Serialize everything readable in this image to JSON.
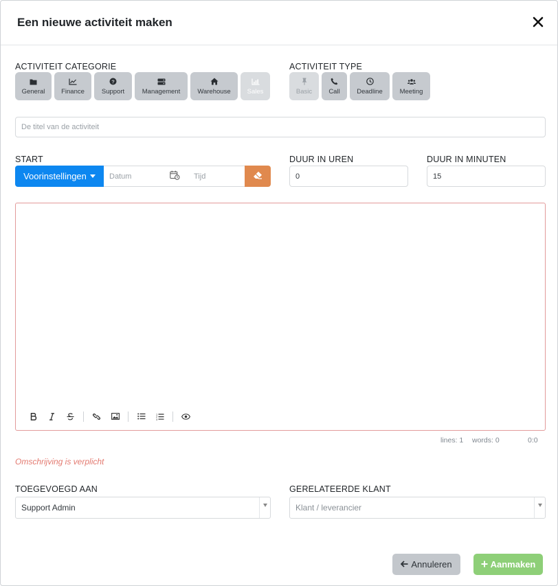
{
  "modal": {
    "title": "Een nieuwe activiteit maken",
    "close_icon": "close-icon"
  },
  "category": {
    "label": "ACTIVITEIT CATEGORIE",
    "items": [
      {
        "label": "General",
        "icon": "folder-icon",
        "disabled": false
      },
      {
        "label": "Finance",
        "icon": "line-chart-icon",
        "disabled": false
      },
      {
        "label": "Support",
        "icon": "question-circle-icon",
        "disabled": false
      },
      {
        "label": "Management",
        "icon": "server-icon",
        "disabled": false
      },
      {
        "label": "Warehouse",
        "icon": "home-icon",
        "disabled": false
      },
      {
        "label": "Sales",
        "icon": "bar-chart-icon",
        "disabled": true
      }
    ]
  },
  "type": {
    "label": "ACTIVITEIT TYPE",
    "items": [
      {
        "label": "Basic",
        "icon": "pin-icon",
        "disabled": true
      },
      {
        "label": "Call",
        "icon": "phone-icon",
        "disabled": false
      },
      {
        "label": "Deadline",
        "icon": "clock-icon",
        "disabled": false
      },
      {
        "label": "Meeting",
        "icon": "users-icon",
        "disabled": false
      }
    ]
  },
  "title_input": {
    "placeholder": "De titel van de activiteit"
  },
  "start": {
    "label": "START",
    "preset_label": "Voorinstellingen",
    "date_placeholder": "Datum",
    "time_placeholder": "Tijd"
  },
  "duration_hours": {
    "label": "DUUR IN UREN",
    "value": "0"
  },
  "duration_minutes": {
    "label": "DUUR IN MINUTEN",
    "value": "15"
  },
  "editor": {
    "status_lines": "lines: 1",
    "status_words": "words: 0",
    "status_cursor": "0:0"
  },
  "error": "Omschrijving is verplicht",
  "assigned": {
    "label": "TOEGEVOEGD AAN",
    "value": "Support Admin"
  },
  "customer": {
    "label": "GERELATEERDE KLANT",
    "placeholder": "Klant / leverancier"
  },
  "actions": {
    "cancel_label": "Annuleren",
    "create_label": "Aanmaken"
  },
  "colors": {
    "primary": "#0d87f0",
    "eraser": "#e0894e",
    "success": "#8ecf78",
    "error": "#e3796f",
    "secondary": "#c3c7cc"
  }
}
